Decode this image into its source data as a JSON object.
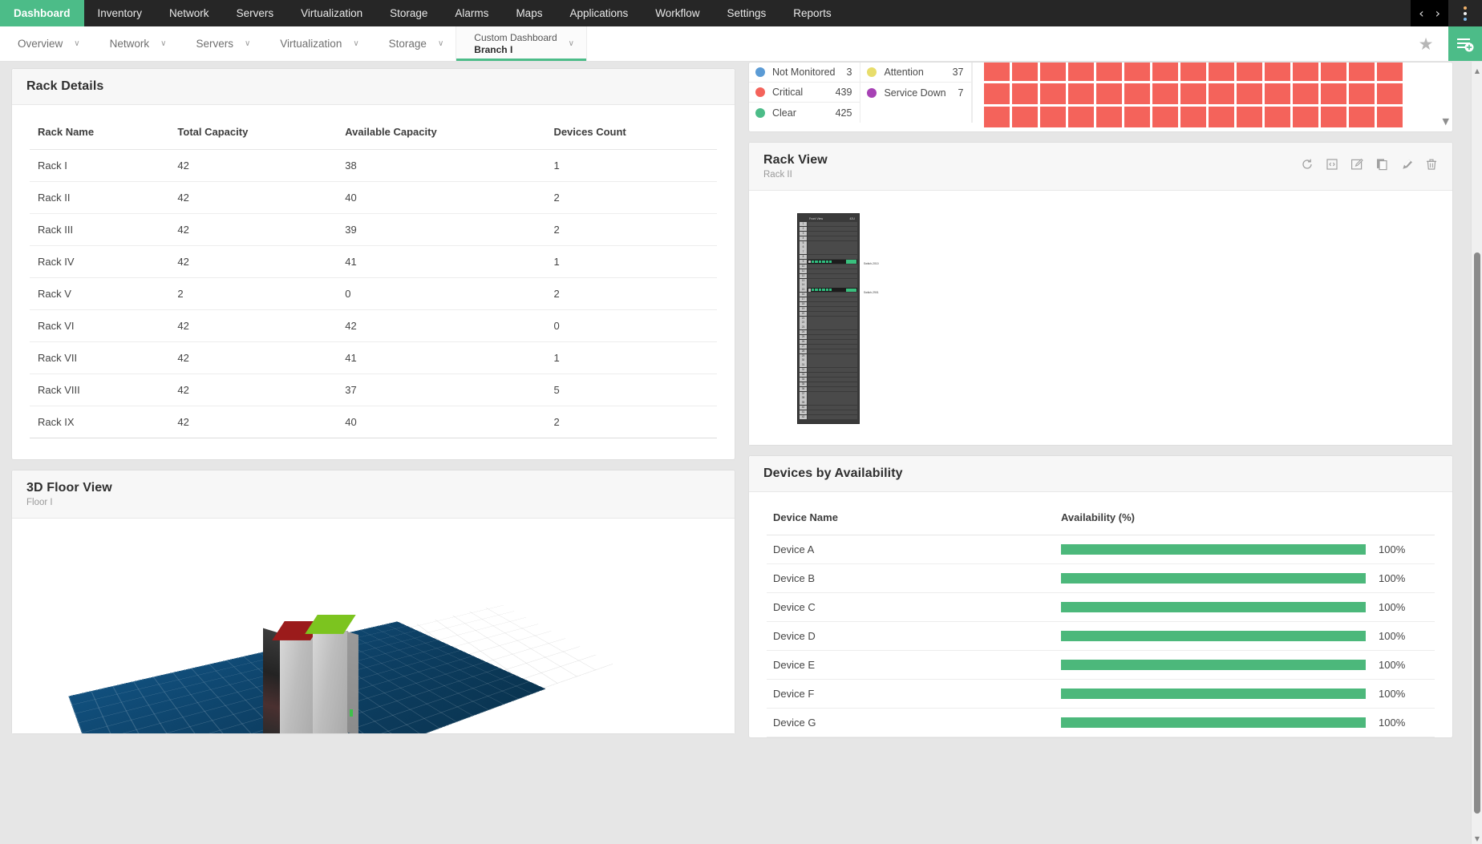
{
  "topnav": {
    "items": [
      {
        "label": "Dashboard",
        "active": true
      },
      {
        "label": "Inventory",
        "active": false
      },
      {
        "label": "Network",
        "active": false
      },
      {
        "label": "Servers",
        "active": false
      },
      {
        "label": "Virtualization",
        "active": false
      },
      {
        "label": "Storage",
        "active": false
      },
      {
        "label": "Alarms",
        "active": false
      },
      {
        "label": "Maps",
        "active": false
      },
      {
        "label": "Applications",
        "active": false
      },
      {
        "label": "Workflow",
        "active": false
      },
      {
        "label": "Settings",
        "active": false
      },
      {
        "label": "Reports",
        "active": false
      }
    ],
    "prev_label": "‹",
    "next_label": "›"
  },
  "subnav": {
    "items": [
      {
        "label": "Overview",
        "caret": "∨"
      },
      {
        "label": "Network",
        "caret": "∨"
      },
      {
        "label": "Servers",
        "caret": "∨"
      },
      {
        "label": "Virtualization",
        "caret": "∨"
      },
      {
        "label": "Storage",
        "caret": "∨"
      }
    ],
    "active_tab": {
      "line1": "Custom Dashboard",
      "line2": "Branch I",
      "caret": "∨"
    },
    "star": "★"
  },
  "status_legend": {
    "items": [
      {
        "label": "Not Monitored",
        "count": "3",
        "color": "#5b9bd5"
      },
      {
        "label": "Critical",
        "count": "439",
        "color": "#f4635b"
      },
      {
        "label": "Clear",
        "count": "425",
        "color": "#4cbc88"
      },
      {
        "label": "Attention",
        "count": "37",
        "color": "#e8dd6b"
      },
      {
        "label": "Service Down",
        "count": "7",
        "color": "#a742b5"
      }
    ],
    "heatmap": {
      "cell_color": "#f4635b",
      "columns": 15,
      "rows": 3,
      "scroll_caret": "▼"
    }
  },
  "rack_details": {
    "title": "Rack Details",
    "columns": [
      "Rack Name",
      "Total Capacity",
      "Available Capacity",
      "Devices Count"
    ],
    "rows": [
      {
        "name": "Rack I",
        "total": "42",
        "available": "38",
        "devices": "1",
        "highlight": false
      },
      {
        "name": "Rack II",
        "total": "42",
        "available": "40",
        "devices": "2",
        "highlight": false
      },
      {
        "name": "Rack III",
        "total": "42",
        "available": "39",
        "devices": "2",
        "highlight": false
      },
      {
        "name": "Rack IV",
        "total": "42",
        "available": "41",
        "devices": "1",
        "highlight": true
      },
      {
        "name": "Rack V",
        "total": "2",
        "available": "0",
        "devices": "2",
        "highlight": false
      },
      {
        "name": "Rack VI",
        "total": "42",
        "available": "42",
        "devices": "0",
        "highlight": false
      },
      {
        "name": "Rack VII",
        "total": "42",
        "available": "41",
        "devices": "1",
        "highlight": false
      },
      {
        "name": "Rack VIII",
        "total": "42",
        "available": "37",
        "devices": "5",
        "highlight": false
      },
      {
        "name": "Rack IX",
        "total": "42",
        "available": "40",
        "devices": "2",
        "highlight": false
      }
    ]
  },
  "floor_view": {
    "title": "3D Floor View",
    "subtitle": "Floor I",
    "floor_color": "#0d4668",
    "rack_top_colors": [
      "#9b1b1b",
      "#7cc41f"
    ]
  },
  "rack_view": {
    "title": "Rack View",
    "subtitle": "Rack II",
    "actions": [
      {
        "name": "refresh-icon",
        "label": "Refresh"
      },
      {
        "name": "embed-icon",
        "label": "Embed"
      },
      {
        "name": "edit-icon",
        "label": "Edit"
      },
      {
        "name": "copy-icon",
        "label": "Copy"
      },
      {
        "name": "pin-icon",
        "label": "Pin"
      },
      {
        "name": "delete-icon",
        "label": "Delete"
      }
    ],
    "diagram": {
      "header_left": "Front View",
      "header_right": "42U",
      "total_units": 42,
      "devices": [
        {
          "unit": 9,
          "label": "Switch-2010"
        },
        {
          "unit": 15,
          "label": "Switch-2901"
        }
      ]
    }
  },
  "devices_availability": {
    "title": "Devices by Availability",
    "columns": [
      "Device Name",
      "Availability (%)"
    ],
    "rows": [
      {
        "name": "Device A",
        "value": 100,
        "label": "100%",
        "highlight": true
      },
      {
        "name": "Device B",
        "value": 100,
        "label": "100%",
        "highlight": false
      },
      {
        "name": "Device C",
        "value": 100,
        "label": "100%",
        "highlight": false
      },
      {
        "name": "Device D",
        "value": 100,
        "label": "100%",
        "highlight": false
      },
      {
        "name": "Device E",
        "value": 100,
        "label": "100%",
        "highlight": false
      },
      {
        "name": "Device F",
        "value": 100,
        "label": "100%",
        "highlight": false
      },
      {
        "name": "Device G",
        "value": 100,
        "label": "100%",
        "highlight": false
      }
    ],
    "bar_color": "#4cb87b"
  },
  "scrollbars": {
    "up_arrow": "▲",
    "down_arrow": "▼"
  }
}
